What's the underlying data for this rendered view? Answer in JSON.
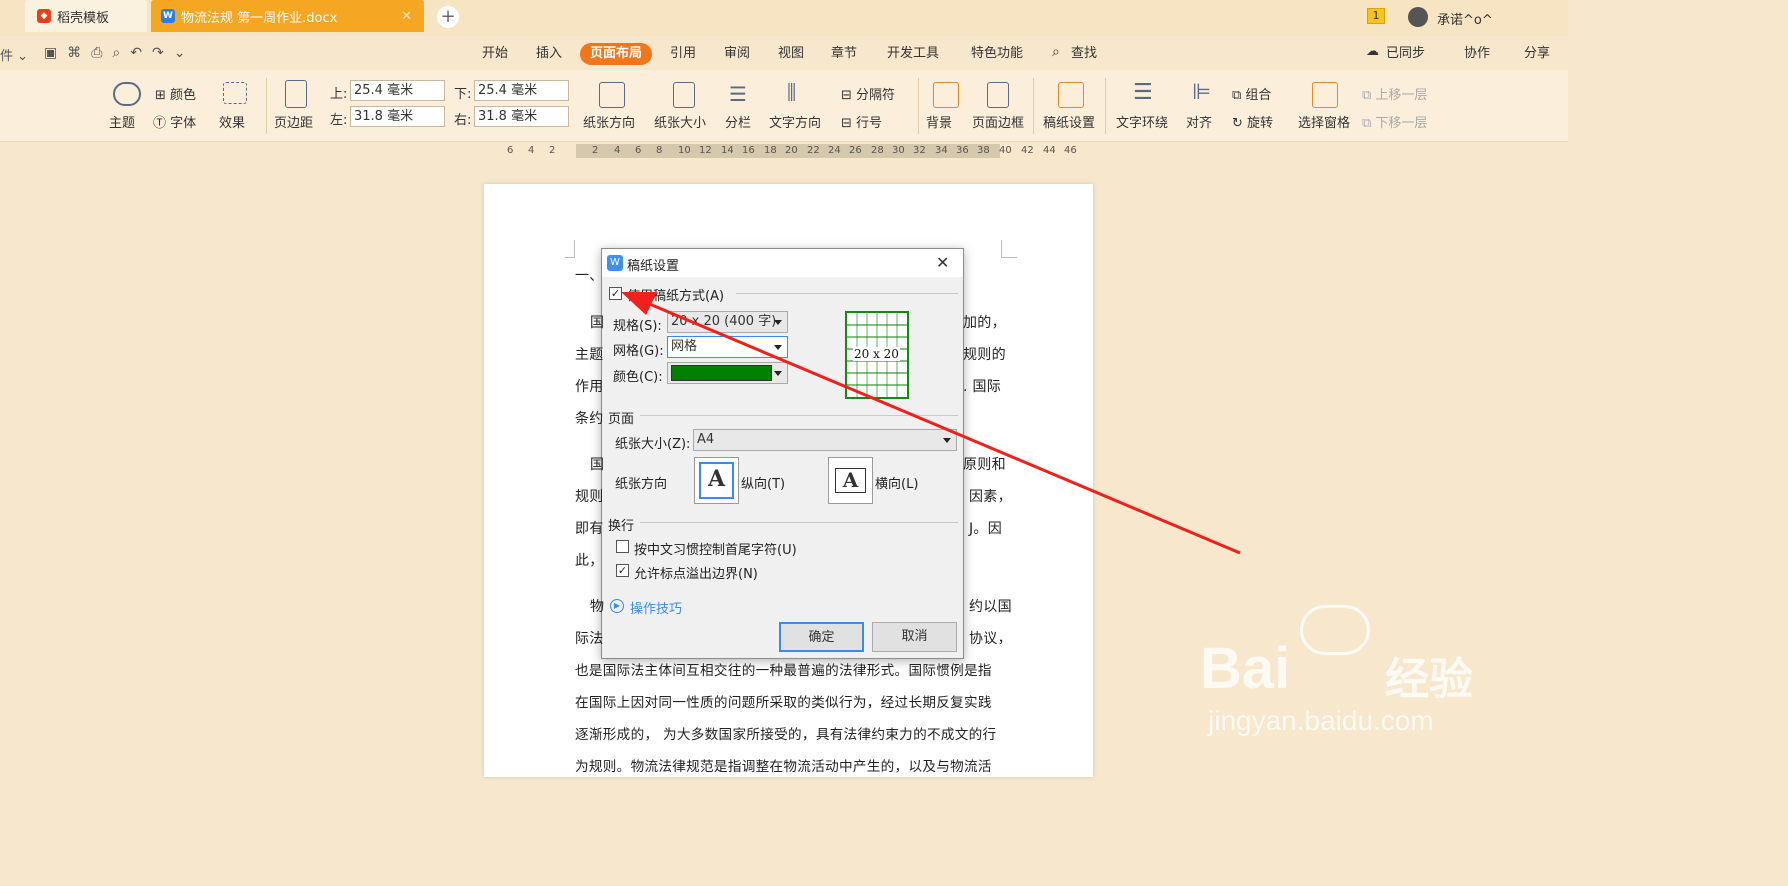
{
  "tabs": {
    "templates": "稻壳模板",
    "document": "物流法规 第一周作业.docx"
  },
  "top_right": {
    "badge": "1",
    "user": "承诺^o^"
  },
  "menu": {
    "items": [
      "开始",
      "插入",
      "页面布局",
      "引用",
      "审阅",
      "视图",
      "章节",
      "开发工具",
      "特色功能",
      "查找"
    ],
    "active": "页面布局"
  },
  "menu_right": {
    "sync": "已同步",
    "collab": "协作",
    "share": "分享"
  },
  "ribbon": {
    "theme": "主题",
    "color": "颜色",
    "font": "字体",
    "effect": "效果",
    "margins": "页边距",
    "top_label": "上:",
    "top_value": "25.4 毫米",
    "bottom_label": "下:",
    "bottom_value": "25.4 毫米",
    "left_label": "左:",
    "left_value": "31.8 毫米",
    "right_label": "右:",
    "right_value": "31.8 毫米",
    "orientation": "纸张方向",
    "size": "纸张大小",
    "columns": "分栏",
    "text_direction": "文字方向",
    "breaks": "分隔符",
    "line_numbers": "行号",
    "background": "背景",
    "page_border": "页面边框",
    "manuscript": "稿纸设置",
    "wrap": "文字环绕",
    "align": "对齐",
    "group": "组合",
    "rotate": "旋转",
    "selection_pane": "选择窗格",
    "bring_forward": "上移一层",
    "send_backward": "下移一层"
  },
  "ruler": [
    "6",
    "4",
    "2",
    "2",
    "4",
    "6",
    "8",
    "10",
    "12",
    "14",
    "16",
    "18",
    "20",
    "22",
    "24",
    "26",
    "28",
    "30",
    "32",
    "34",
    "36",
    "38",
    "40",
    "42",
    "44",
    "46"
  ],
  "document": {
    "heading": "一、",
    "left_frag": [
      "国",
      "主题",
      "作用",
      "条约",
      "国",
      "规则",
      "即有",
      "此，",
      "物",
      "际法"
    ],
    "right_frag": [
      "加的，",
      "规则的",
      ". 国际",
      "原则和",
      "因素，",
      "J。因",
      "约以国",
      "协议，"
    ],
    "full_lines": [
      "也是国际法主体间互相交往的一种最普遍的法律形式。国际惯例是指",
      "在国际上因对同一性质的问题所采取的类似行为，经过长期反复实践",
      "逐渐形成的， 为大多数国家所接受的，具有法律约束力的不成文的行",
      "为规则。物流法律规范是指调整在物流活动中产生的，以及与物流活"
    ]
  },
  "dialog": {
    "title": "稿纸设置",
    "use_label": "使用稿纸方式(A)",
    "use_checked": true,
    "spec_label": "规格(S):",
    "spec_value": "20 x 20 (400 字)",
    "grid_label": "网格(G):",
    "grid_value": "网格",
    "color_label": "颜色(C):",
    "color_value": "#008000",
    "preview_text": "20 x 20",
    "page_section": "页面",
    "paper_size_label": "纸张大小(Z):",
    "paper_size_value": "A4",
    "orientation_label": "纸张方向",
    "portrait": "纵向(T)",
    "landscape": "横向(L)",
    "linebreak_section": "换行",
    "cb1": "按中文习惯控制首尾字符(U)",
    "cb1_checked": false,
    "cb2": "允许标点溢出边界(N)",
    "cb2_checked": true,
    "tips": "操作技巧",
    "ok": "确定",
    "cancel": "取消"
  },
  "watermark": {
    "brand": "Bai",
    "cn": "经验",
    "site": "jingyan.baidu.com"
  }
}
